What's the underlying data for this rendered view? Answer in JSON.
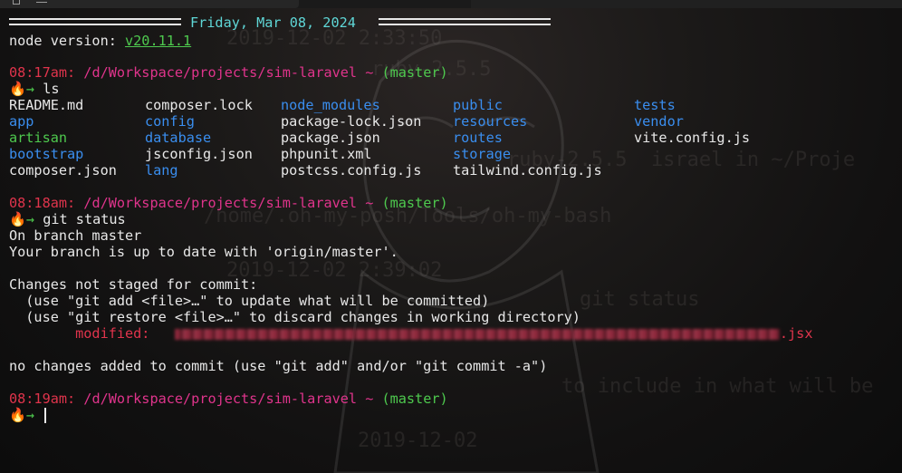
{
  "header": {
    "date": "Friday, Mar 08, 2024"
  },
  "node": {
    "label": "node version: ",
    "version": "v20.11.1"
  },
  "prompts": [
    {
      "time": "08:17am:",
      "path": " /d/Workspace/projects/sim-laravel",
      "tilde": " ~",
      "branch": " (master)"
    },
    {
      "time": "08:18am:",
      "path": " /d/Workspace/projects/sim-laravel",
      "tilde": " ~",
      "branch": " (master)"
    },
    {
      "time": "08:19am:",
      "path": " /d/Workspace/projects/sim-laravel",
      "tilde": " ~",
      "branch": " (master)"
    }
  ],
  "prompt_symbol": "🔥",
  "prompt_arrow": "→",
  "commands": [
    "ls",
    "git status"
  ],
  "ls_output": {
    "col1": [
      {
        "name": "README.md",
        "color": "#e8e8e8"
      },
      {
        "name": "app",
        "color": "#3a8eef"
      },
      {
        "name": "artisan",
        "color": "#4ec94e"
      },
      {
        "name": "bootstrap",
        "color": "#3a8eef"
      },
      {
        "name": "composer.json",
        "color": "#e8e8e8"
      }
    ],
    "col2": [
      {
        "name": "composer.lock",
        "color": "#e8e8e8"
      },
      {
        "name": "config",
        "color": "#3a8eef"
      },
      {
        "name": "database",
        "color": "#3a8eef"
      },
      {
        "name": "jsconfig.json",
        "color": "#e8e8e8"
      },
      {
        "name": "lang",
        "color": "#3a8eef"
      }
    ],
    "col3": [
      {
        "name": "node_modules",
        "color": "#3a8eef"
      },
      {
        "name": "package-lock.json",
        "color": "#e8e8e8"
      },
      {
        "name": "package.json",
        "color": "#e8e8e8"
      },
      {
        "name": "phpunit.xml",
        "color": "#e8e8e8"
      },
      {
        "name": "postcss.config.js",
        "color": "#e8e8e8"
      }
    ],
    "col4": [
      {
        "name": "public",
        "color": "#3a8eef"
      },
      {
        "name": "resources",
        "color": "#3a8eef"
      },
      {
        "name": "routes",
        "color": "#3a8eef"
      },
      {
        "name": "storage",
        "color": "#3a8eef"
      },
      {
        "name": "tailwind.config.js",
        "color": "#e8e8e8"
      }
    ],
    "col5": [
      {
        "name": "tests",
        "color": "#3a8eef"
      },
      {
        "name": "vendor",
        "color": "#3a8eef"
      },
      {
        "name": "vite.config.js",
        "color": "#e8e8e8"
      }
    ]
  },
  "git_status": {
    "line1": "On branch master",
    "line2": "Your branch is up to date with 'origin/master'.",
    "line3": "Changes not staged for commit:",
    "line4": "  (use \"git add <file>…\" to update what will be committed)",
    "line5": "  (use \"git restore <file>…\" to discard changes in working directory)",
    "modified_label": "        modified:",
    "modified_suffix": ".jsx",
    "line7": "no changes added to commit (use \"git add\" and/or \"git commit -a\")"
  },
  "background_text": {
    "g1": "2019-12-02 2:33:50",
    "g2": "ruby-2.5.5",
    "g3": "ruby-2.5.5  israel in ~/Proje",
    "g4": "/home/.oh-my-posh/Tools/oh-my-bash",
    "g5": "2019-12-02 2:39:02",
    "g6": "git status",
    "g7": "to include in what will be",
    "g8": "2019-12-02"
  },
  "colors": {
    "background": "#0c0c0c",
    "text": "#e8e8e8",
    "green": "#4ec94e",
    "pink": "#e0348c",
    "red": "#e0344c",
    "blue": "#3a8eef",
    "cyan": "#5fd7d7"
  }
}
